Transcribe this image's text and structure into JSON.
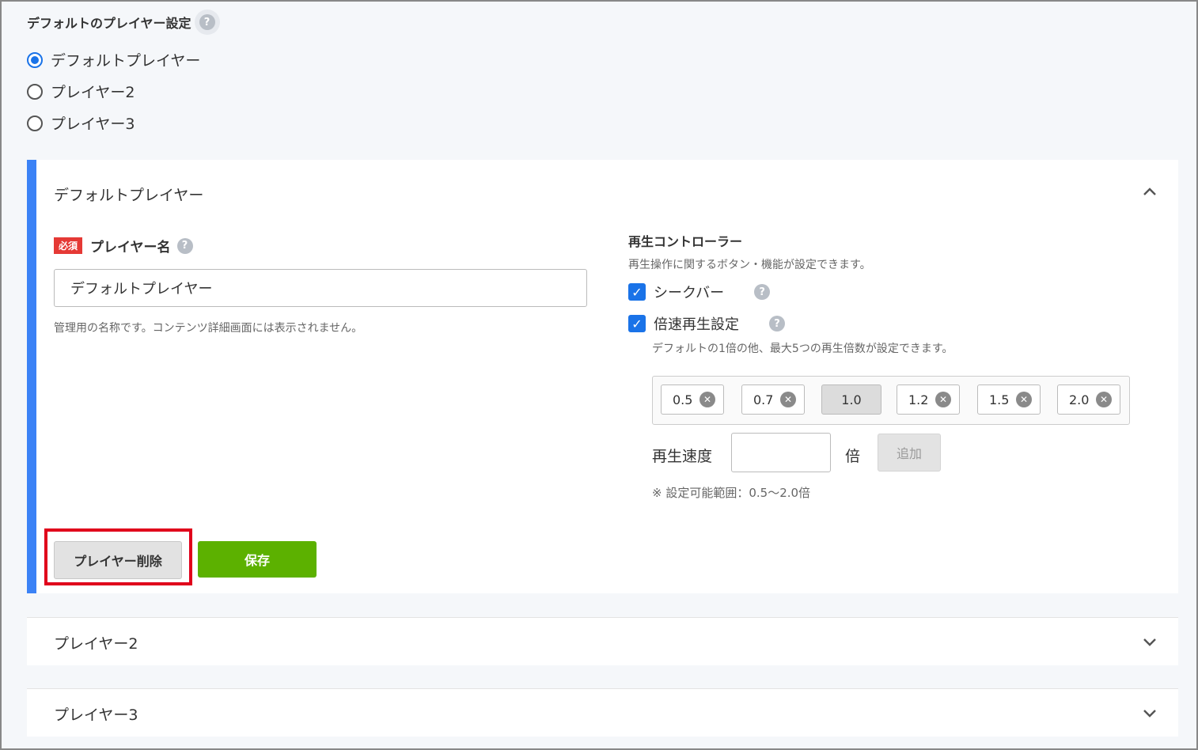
{
  "default_setting": {
    "title": "デフォルトのプレイヤー設定",
    "help_icon": "question-circle-icon",
    "options": [
      {
        "label": "デフォルトプレイヤー",
        "checked": true
      },
      {
        "label": "プレイヤー2",
        "checked": false
      },
      {
        "label": "プレイヤー3",
        "checked": false
      }
    ]
  },
  "panel": {
    "title": "デフォルトプレイヤー",
    "chevron_up": "⌃",
    "required_badge": "必須",
    "player_name_label": "プレイヤー名",
    "player_name_value": "デフォルトプレイヤー",
    "player_name_note": "管理用の名称です。コンテンツ詳細画面には表示されません。",
    "controller_title": "再生コントローラー",
    "controller_desc": "再生操作に関するボタン・機能が設定できます。",
    "seekbar_label": "シークバー",
    "speed_setting_label": "倍速再生設定",
    "speed_desc": "デフォルトの1倍の他、最大5つの再生倍数が設定できます。",
    "speeds": [
      {
        "value": "0.5",
        "removable": true
      },
      {
        "value": "0.7",
        "removable": true
      },
      {
        "value": "1.0",
        "removable": false
      },
      {
        "value": "1.2",
        "removable": true
      },
      {
        "value": "1.5",
        "removable": true
      },
      {
        "value": "2.0",
        "removable": true
      }
    ],
    "speed_input_label": "再生速度",
    "speed_input_value": "",
    "speed_unit": "倍",
    "add_label": "追加",
    "range_note": "※ 設定可能範囲：0.5〜2.0倍",
    "delete_label": "プレイヤー削除",
    "save_label": "保存",
    "accent_color": "#3b82f6",
    "save_color": "#5cb100",
    "highlight_color": "#e0001b"
  },
  "collapsed_panels": [
    {
      "title": "プレイヤー2",
      "chevron": "⌄"
    },
    {
      "title": "プレイヤー3",
      "chevron": "⌄"
    }
  ]
}
